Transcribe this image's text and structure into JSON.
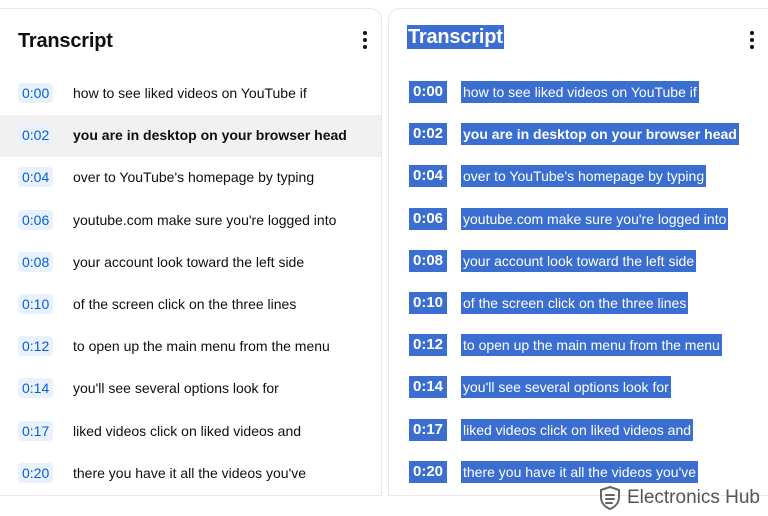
{
  "left_panel": {
    "title": "Transcript",
    "menu_icon": "more-vert-icon",
    "active_index": 1
  },
  "right_panel": {
    "title": "Transcript",
    "menu_icon": "more-vert-icon",
    "selection_color": "#3a6fd1"
  },
  "segments": [
    {
      "time": "0:00",
      "text": "how to see liked videos on YouTube if"
    },
    {
      "time": "0:02",
      "text": "you are in desktop on your browser head"
    },
    {
      "time": "0:04",
      "text": "over to YouTube's homepage by typing"
    },
    {
      "time": "0:06",
      "text": "youtube.com make sure you're logged into"
    },
    {
      "time": "0:08",
      "text": "your account look toward the left side"
    },
    {
      "time": "0:10",
      "text": "of the screen click on the three lines"
    },
    {
      "time": "0:12",
      "text": "to open up the main menu from the menu"
    },
    {
      "time": "0:14",
      "text": "you'll see several options look for"
    },
    {
      "time": "0:17",
      "text": "liked videos click on liked videos and"
    },
    {
      "time": "0:20",
      "text": "there you have it all the videos you've"
    }
  ],
  "watermark": {
    "text": "Electronics Hub",
    "logo_icon": "electronics-hub-logo-icon"
  },
  "colors": {
    "timestamp_text": "#065fd4",
    "timestamp_bg": "#e9f1fd",
    "active_row_bg": "#f1f1f1"
  }
}
